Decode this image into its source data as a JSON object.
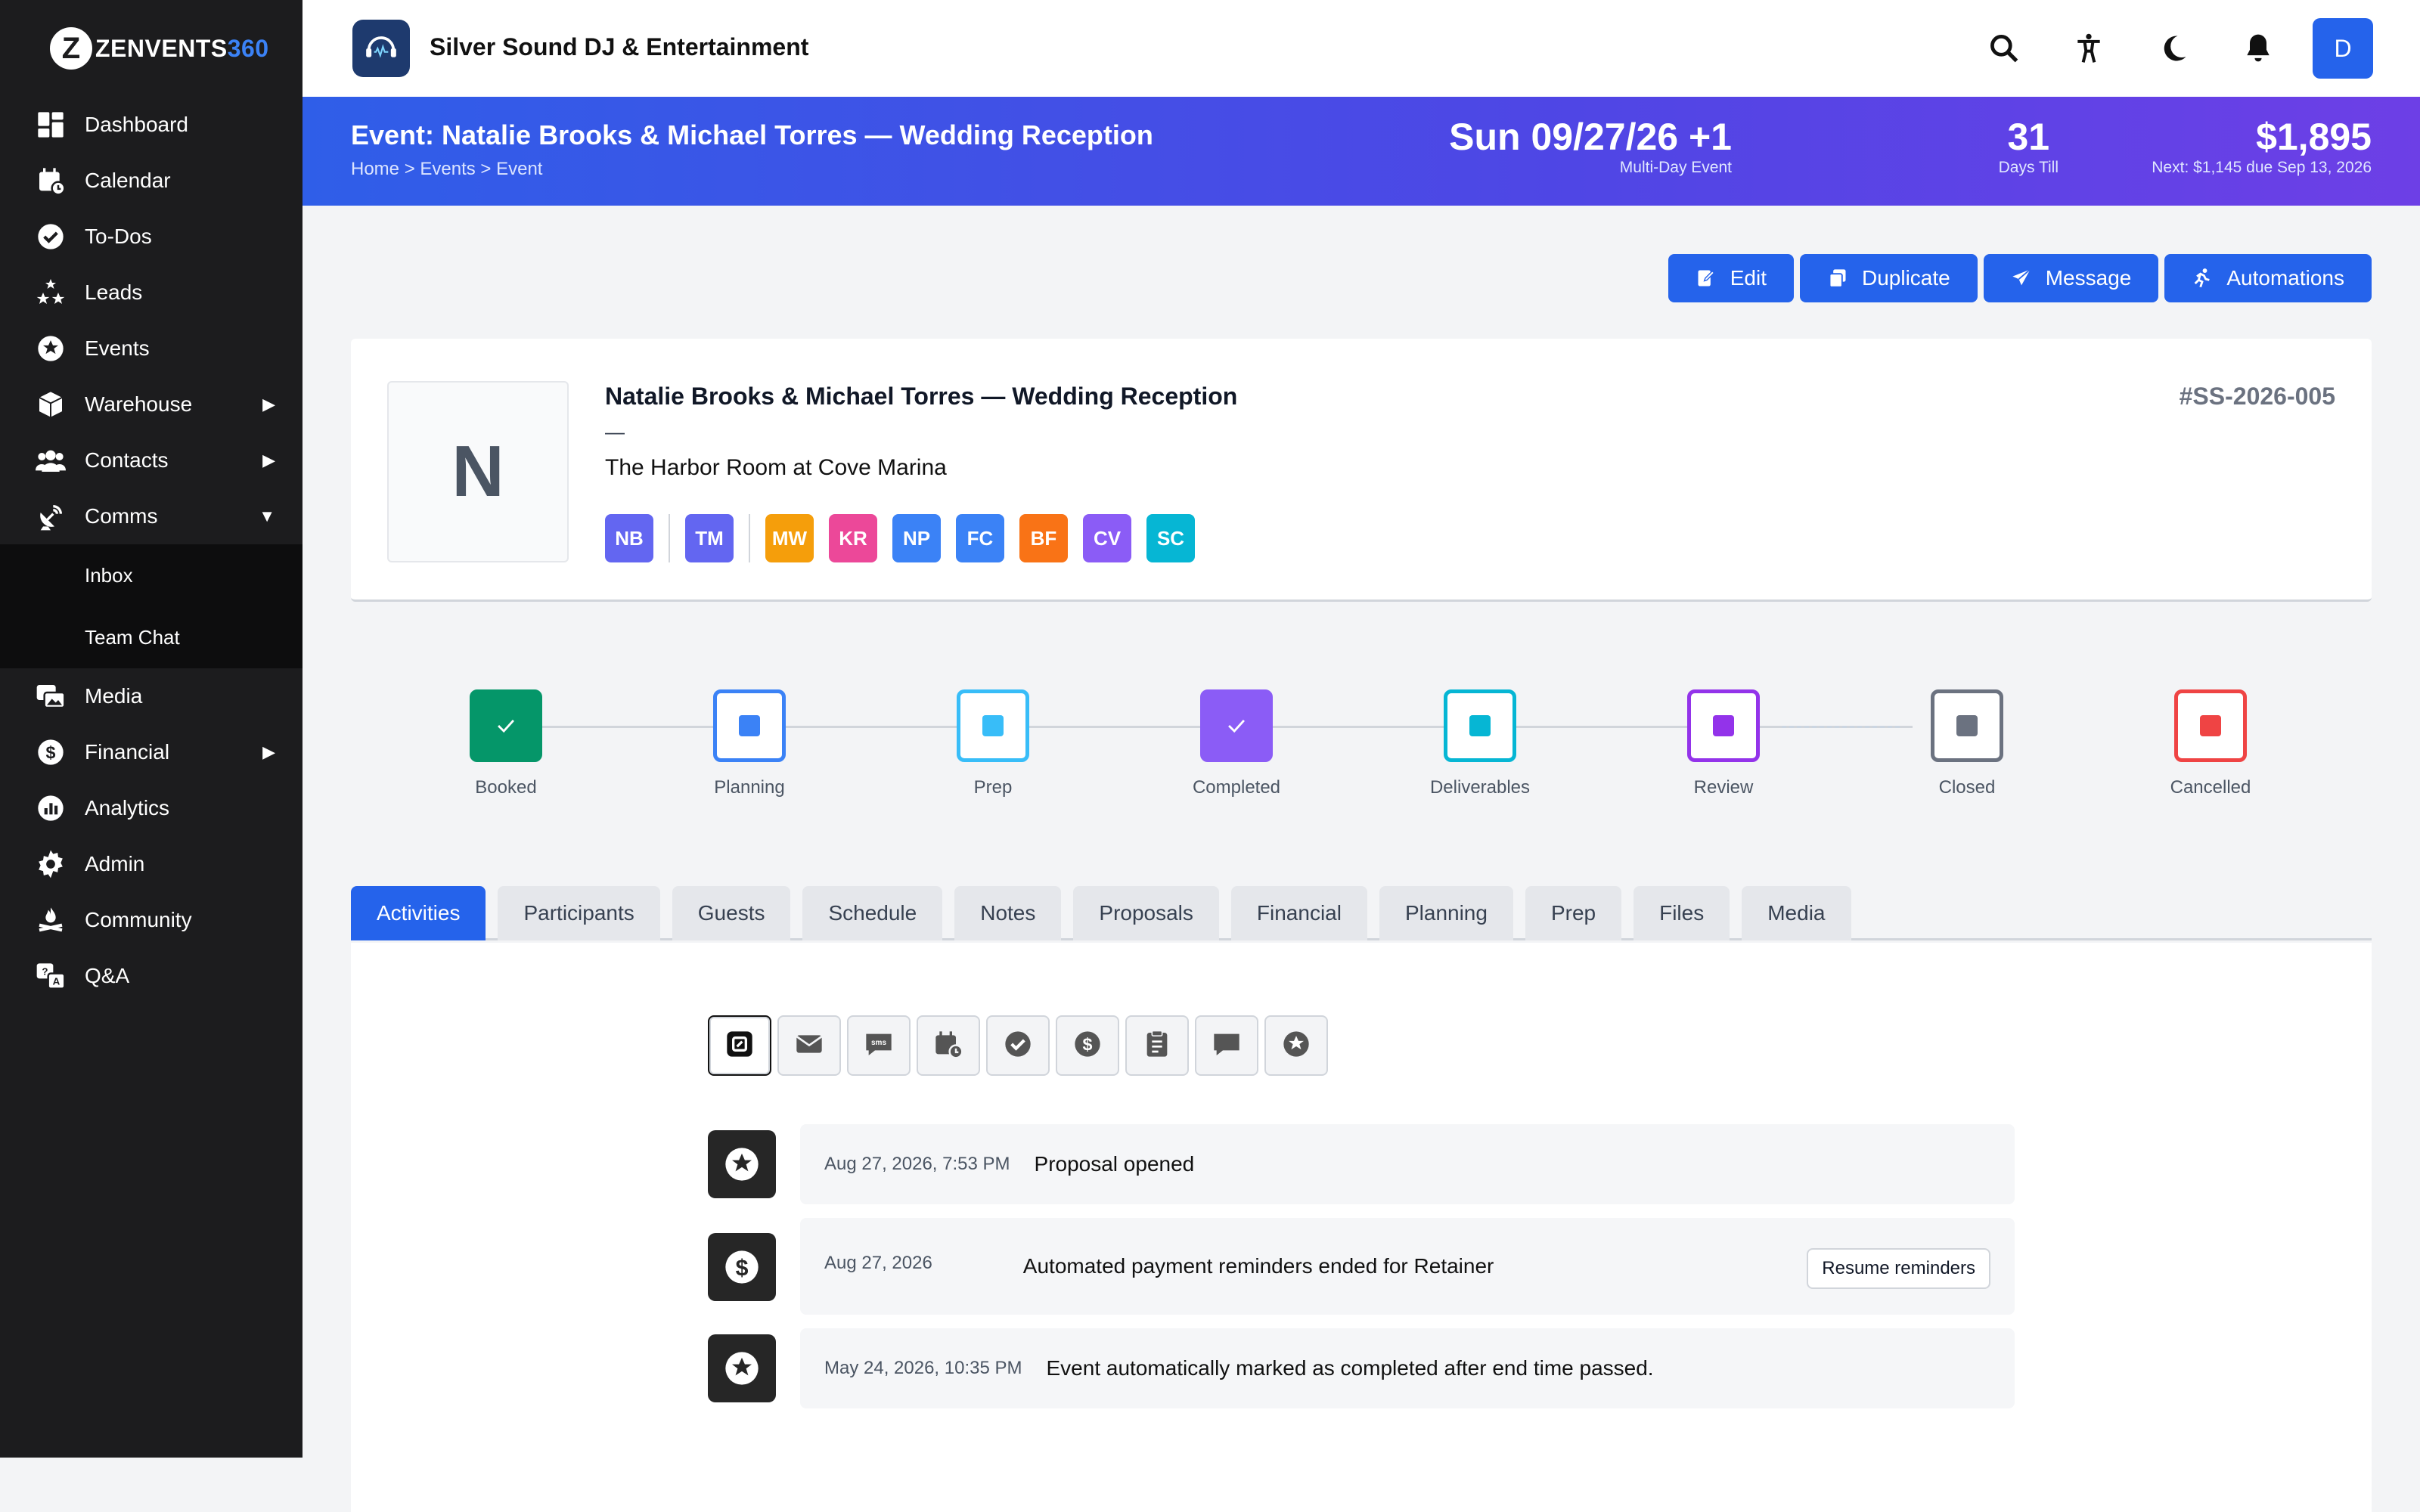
{
  "app": {
    "logo_letter": "Z",
    "logo_main": "ZENVENTS",
    "logo_accent": "360",
    "brand_name": "Silver Sound DJ & Entertainment",
    "user_initial": "D"
  },
  "sidebar": {
    "items": [
      {
        "label": "Dashboard",
        "icon": "dashboard-icon"
      },
      {
        "label": "Calendar",
        "icon": "calendar-icon"
      },
      {
        "label": "To-Dos",
        "icon": "check-circle-icon"
      },
      {
        "label": "Leads",
        "icon": "stars-icon"
      },
      {
        "label": "Events",
        "icon": "star-circle-icon"
      },
      {
        "label": "Warehouse",
        "icon": "box-icon",
        "caret": "▶"
      },
      {
        "label": "Contacts",
        "icon": "users-icon",
        "caret": "▶"
      },
      {
        "label": "Comms",
        "icon": "satellite-icon",
        "caret": "▼"
      }
    ],
    "sub_items": [
      {
        "label": "Inbox"
      },
      {
        "label": "Team Chat"
      }
    ],
    "items_after": [
      {
        "label": "Media",
        "icon": "photos-icon"
      },
      {
        "label": "Financial",
        "icon": "dollar-circle-icon",
        "caret": "▶"
      },
      {
        "label": "Analytics",
        "icon": "chart-icon"
      },
      {
        "label": "Admin",
        "icon": "gear-icon"
      },
      {
        "label": "Community",
        "icon": "campfire-icon"
      },
      {
        "label": "Q&A",
        "icon": "qa-icon"
      }
    ]
  },
  "banner": {
    "title": "Event: Natalie Brooks & Michael Torres — Wedding Reception",
    "breadcrumb": "Home > Events > Event",
    "date": "Sun 09/27/26 +1",
    "date_sub": "Multi-Day Event",
    "days": "31",
    "days_sub": "Days Till",
    "amount": "$1,895",
    "amount_sub": "Next: $1,145 due Sep 13, 2026"
  },
  "actions": {
    "edit": "Edit",
    "duplicate": "Duplicate",
    "message": "Message",
    "automations": "Automations"
  },
  "event_card": {
    "avatar_letter": "N",
    "title": "Natalie Brooks & Michael Torres — Wedding Reception",
    "dash": "—",
    "venue": "The Harbor Room at Cove Marina",
    "event_id": "#SS-2026-005",
    "clients": [
      {
        "initials": "NB",
        "color": "#6366f1"
      },
      {
        "initials": "TM",
        "color": "#6366f1"
      }
    ],
    "staff": [
      {
        "initials": "MW",
        "color": "#f59e0b"
      },
      {
        "initials": "KR",
        "color": "#ec4899"
      },
      {
        "initials": "NP",
        "color": "#3b82f6"
      },
      {
        "initials": "FC",
        "color": "#3b82f6"
      },
      {
        "initials": "BF",
        "color": "#f97316"
      },
      {
        "initials": "CV",
        "color": "#8b5cf6"
      },
      {
        "initials": "SC",
        "color": "#06b6d4"
      }
    ]
  },
  "stages": [
    {
      "label": "Booked",
      "color": "#059669",
      "state": "done"
    },
    {
      "label": "Planning",
      "color": "#3b82f6",
      "state": "todo"
    },
    {
      "label": "Prep",
      "color": "#38bdf8",
      "state": "todo"
    },
    {
      "label": "Completed",
      "color": "#8b5cf6",
      "state": "done"
    },
    {
      "label": "Deliverables",
      "color": "#06b6d4",
      "state": "todo"
    },
    {
      "label": "Review",
      "color": "#9333ea",
      "state": "todo"
    },
    {
      "label": "Closed",
      "color": "#6b7280",
      "state": "todo"
    },
    {
      "label": "Cancelled",
      "color": "#ef4444",
      "state": "todo"
    }
  ],
  "tabs": [
    "Activities",
    "Participants",
    "Guests",
    "Schedule",
    "Notes",
    "Proposals",
    "Financial",
    "Planning",
    "Prep",
    "Files",
    "Media"
  ],
  "active_tab": "Activities",
  "filters": [
    "all-icon",
    "email-icon",
    "sms-icon",
    "calendar-clock-icon",
    "check-circle-icon",
    "dollar-circle-icon",
    "document-icon",
    "chat-icon",
    "star-circle-icon"
  ],
  "activities": [
    {
      "icon": "star-circle-icon",
      "date": "Aug 27, 2026, 7:53 PM",
      "text": "Proposal opened"
    },
    {
      "icon": "dollar-circle-icon",
      "date": "Aug 27, 2026",
      "text": "Automated payment reminders ended for Retainer",
      "button": "Resume reminders"
    },
    {
      "icon": "star-circle-icon",
      "date": "May 24, 2026, 10:35 PM",
      "text": "Event automatically marked as completed after end time passed."
    }
  ]
}
